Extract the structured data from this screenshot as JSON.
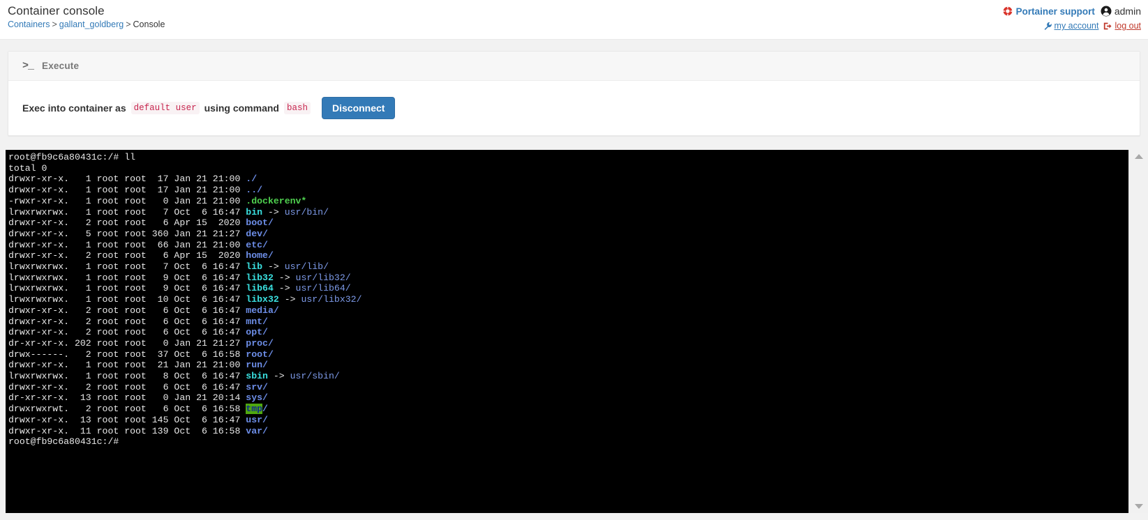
{
  "header": {
    "title": "Container console",
    "breadcrumb": {
      "root": "Containers",
      "container": "gallant_goldberg",
      "current": "Console",
      "separator": ">"
    },
    "support_label": "Portainer support",
    "user_name": "admin",
    "my_account_label": "my account",
    "logout_label": "log out",
    "accent_blue": "#337ab7",
    "logout_red": "#c0392b",
    "support_red": "#d9342b"
  },
  "execute_card": {
    "header_label": "Execute",
    "header_icon": "terminal-prompt-icon",
    "exec_text_1": "Exec into container as",
    "user_code": "default user",
    "exec_text_2": "using command",
    "command_code": "bash",
    "disconnect_label": "Disconnect",
    "button_color": "#337ab7"
  },
  "terminal": {
    "background": "#000000",
    "prompt": "root@fb9c6a80431c:/#",
    "command": "ll",
    "total_line": "total 0",
    "trailing_prompt": "root@fb9c6a80431c:/#",
    "colors": {
      "text": "#e8e8e8",
      "directory": "#6d8ee8",
      "executable": "#4fd14f",
      "symlink": "#3ae0e0",
      "symlink_target": "#7d9ae8",
      "sticky_dir_bg": "#4fa80f",
      "sticky_dir_fg": "#0f2b8c"
    },
    "rows": [
      {
        "perms": "drwxr-xr-x.",
        "links": "1",
        "owner": "root",
        "group": "root",
        "size": "17",
        "month": "Jan",
        "day": "21",
        "time": "21:00",
        "name": "./",
        "kind": "dir"
      },
      {
        "perms": "drwxr-xr-x.",
        "links": "1",
        "owner": "root",
        "group": "root",
        "size": "17",
        "month": "Jan",
        "day": "21",
        "time": "21:00",
        "name": "../",
        "kind": "dir"
      },
      {
        "perms": "-rwxr-xr-x.",
        "links": "1",
        "owner": "root",
        "group": "root",
        "size": "0",
        "month": "Jan",
        "day": "21",
        "time": "21:00",
        "name": ".dockerenv*",
        "kind": "exec"
      },
      {
        "perms": "lrwxrwxrwx.",
        "links": "1",
        "owner": "root",
        "group": "root",
        "size": "7",
        "month": "Oct",
        "day": "6",
        "time": "16:47",
        "name": "bin",
        "kind": "link",
        "target": "usr/bin/"
      },
      {
        "perms": "drwxr-xr-x.",
        "links": "2",
        "owner": "root",
        "group": "root",
        "size": "6",
        "month": "Apr",
        "day": "15",
        "time": "2020",
        "name": "boot/",
        "kind": "dir"
      },
      {
        "perms": "drwxr-xr-x.",
        "links": "5",
        "owner": "root",
        "group": "root",
        "size": "360",
        "month": "Jan",
        "day": "21",
        "time": "21:27",
        "name": "dev/",
        "kind": "dir"
      },
      {
        "perms": "drwxr-xr-x.",
        "links": "1",
        "owner": "root",
        "group": "root",
        "size": "66",
        "month": "Jan",
        "day": "21",
        "time": "21:00",
        "name": "etc/",
        "kind": "dir"
      },
      {
        "perms": "drwxr-xr-x.",
        "links": "2",
        "owner": "root",
        "group": "root",
        "size": "6",
        "month": "Apr",
        "day": "15",
        "time": "2020",
        "name": "home/",
        "kind": "dir"
      },
      {
        "perms": "lrwxrwxrwx.",
        "links": "1",
        "owner": "root",
        "group": "root",
        "size": "7",
        "month": "Oct",
        "day": "6",
        "time": "16:47",
        "name": "lib",
        "kind": "link",
        "target": "usr/lib/"
      },
      {
        "perms": "lrwxrwxrwx.",
        "links": "1",
        "owner": "root",
        "group": "root",
        "size": "9",
        "month": "Oct",
        "day": "6",
        "time": "16:47",
        "name": "lib32",
        "kind": "link",
        "target": "usr/lib32/"
      },
      {
        "perms": "lrwxrwxrwx.",
        "links": "1",
        "owner": "root",
        "group": "root",
        "size": "9",
        "month": "Oct",
        "day": "6",
        "time": "16:47",
        "name": "lib64",
        "kind": "link",
        "target": "usr/lib64/"
      },
      {
        "perms": "lrwxrwxrwx.",
        "links": "1",
        "owner": "root",
        "group": "root",
        "size": "10",
        "month": "Oct",
        "day": "6",
        "time": "16:47",
        "name": "libx32",
        "kind": "link",
        "target": "usr/libx32/"
      },
      {
        "perms": "drwxr-xr-x.",
        "links": "2",
        "owner": "root",
        "group": "root",
        "size": "6",
        "month": "Oct",
        "day": "6",
        "time": "16:47",
        "name": "media/",
        "kind": "dir"
      },
      {
        "perms": "drwxr-xr-x.",
        "links": "2",
        "owner": "root",
        "group": "root",
        "size": "6",
        "month": "Oct",
        "day": "6",
        "time": "16:47",
        "name": "mnt/",
        "kind": "dir"
      },
      {
        "perms": "drwxr-xr-x.",
        "links": "2",
        "owner": "root",
        "group": "root",
        "size": "6",
        "month": "Oct",
        "day": "6",
        "time": "16:47",
        "name": "opt/",
        "kind": "dir"
      },
      {
        "perms": "dr-xr-xr-x.",
        "links": "202",
        "owner": "root",
        "group": "root",
        "size": "0",
        "month": "Jan",
        "day": "21",
        "time": "21:27",
        "name": "proc/",
        "kind": "dir"
      },
      {
        "perms": "drwx------.",
        "links": "2",
        "owner": "root",
        "group": "root",
        "size": "37",
        "month": "Oct",
        "day": "6",
        "time": "16:58",
        "name": "root/",
        "kind": "dir"
      },
      {
        "perms": "drwxr-xr-x.",
        "links": "1",
        "owner": "root",
        "group": "root",
        "size": "21",
        "month": "Jan",
        "day": "21",
        "time": "21:00",
        "name": "run/",
        "kind": "dir"
      },
      {
        "perms": "lrwxrwxrwx.",
        "links": "1",
        "owner": "root",
        "group": "root",
        "size": "8",
        "month": "Oct",
        "day": "6",
        "time": "16:47",
        "name": "sbin",
        "kind": "link",
        "target": "usr/sbin/"
      },
      {
        "perms": "drwxr-xr-x.",
        "links": "2",
        "owner": "root",
        "group": "root",
        "size": "6",
        "month": "Oct",
        "day": "6",
        "time": "16:47",
        "name": "srv/",
        "kind": "dir"
      },
      {
        "perms": "dr-xr-xr-x.",
        "links": "13",
        "owner": "root",
        "group": "root",
        "size": "0",
        "month": "Jan",
        "day": "21",
        "time": "20:14",
        "name": "sys/",
        "kind": "dir"
      },
      {
        "perms": "drwxrwxrwt.",
        "links": "2",
        "owner": "root",
        "group": "root",
        "size": "6",
        "month": "Oct",
        "day": "6",
        "time": "16:58",
        "name": "tmp",
        "kind": "sticky"
      },
      {
        "perms": "drwxr-xr-x.",
        "links": "13",
        "owner": "root",
        "group": "root",
        "size": "145",
        "month": "Oct",
        "day": "6",
        "time": "16:47",
        "name": "usr/",
        "kind": "dir"
      },
      {
        "perms": "drwxr-xr-x.",
        "links": "11",
        "owner": "root",
        "group": "root",
        "size": "139",
        "month": "Oct",
        "day": "6",
        "time": "16:58",
        "name": "var/",
        "kind": "dir"
      }
    ]
  }
}
